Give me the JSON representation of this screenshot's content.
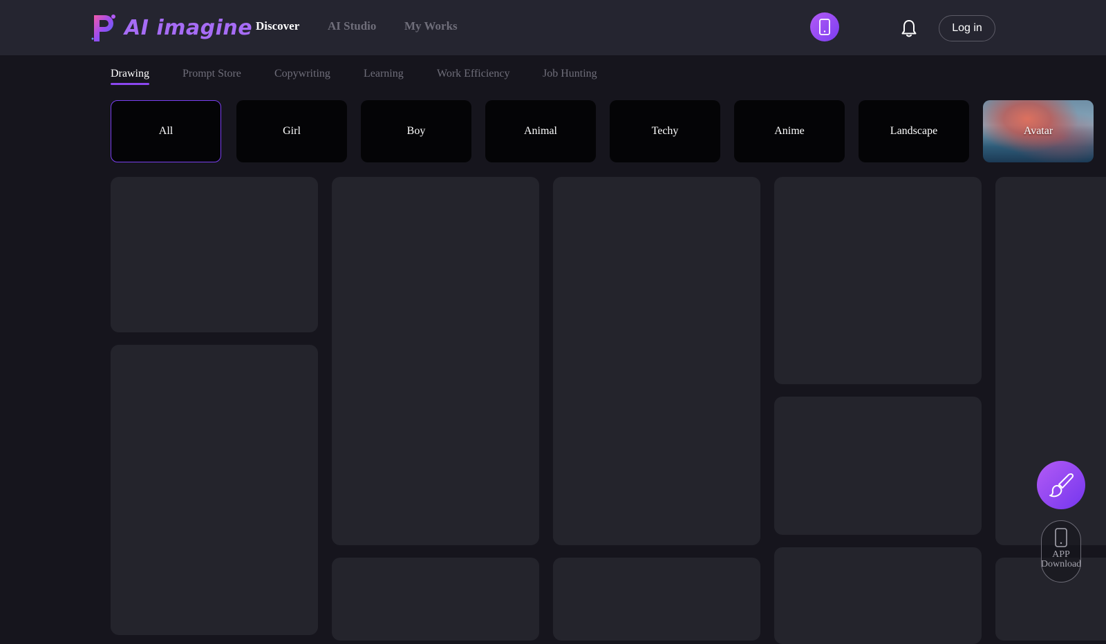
{
  "header": {
    "logo_text": "AI imagine",
    "nav": [
      {
        "label": "Discover",
        "active": true
      },
      {
        "label": "AI Studio",
        "active": false
      },
      {
        "label": "My Works",
        "active": false
      }
    ],
    "login_label": "Log in"
  },
  "subtabs": [
    {
      "label": "Drawing",
      "active": true
    },
    {
      "label": "Prompt Store",
      "active": false
    },
    {
      "label": "Copywriting",
      "active": false
    },
    {
      "label": "Learning",
      "active": false
    },
    {
      "label": "Work Efficiency",
      "active": false
    },
    {
      "label": "Job Hunting",
      "active": false
    }
  ],
  "categories": [
    {
      "label": "All",
      "active": true
    },
    {
      "label": "Girl",
      "active": false
    },
    {
      "label": "Boy",
      "active": false
    },
    {
      "label": "Animal",
      "active": false
    },
    {
      "label": "Techy",
      "active": false
    },
    {
      "label": "Anime",
      "active": false
    },
    {
      "label": "Landscape",
      "active": false
    },
    {
      "label": "Avatar",
      "active": false
    }
  ],
  "app_download": {
    "line1": "APP",
    "line2": "Download"
  },
  "icons": {
    "phone": "phone-icon",
    "bell": "bell-icon",
    "brush": "brush-icon"
  },
  "colors": {
    "accent": "#8b47f0",
    "background": "#16151d",
    "header": "#252530",
    "card": "#24242c"
  }
}
